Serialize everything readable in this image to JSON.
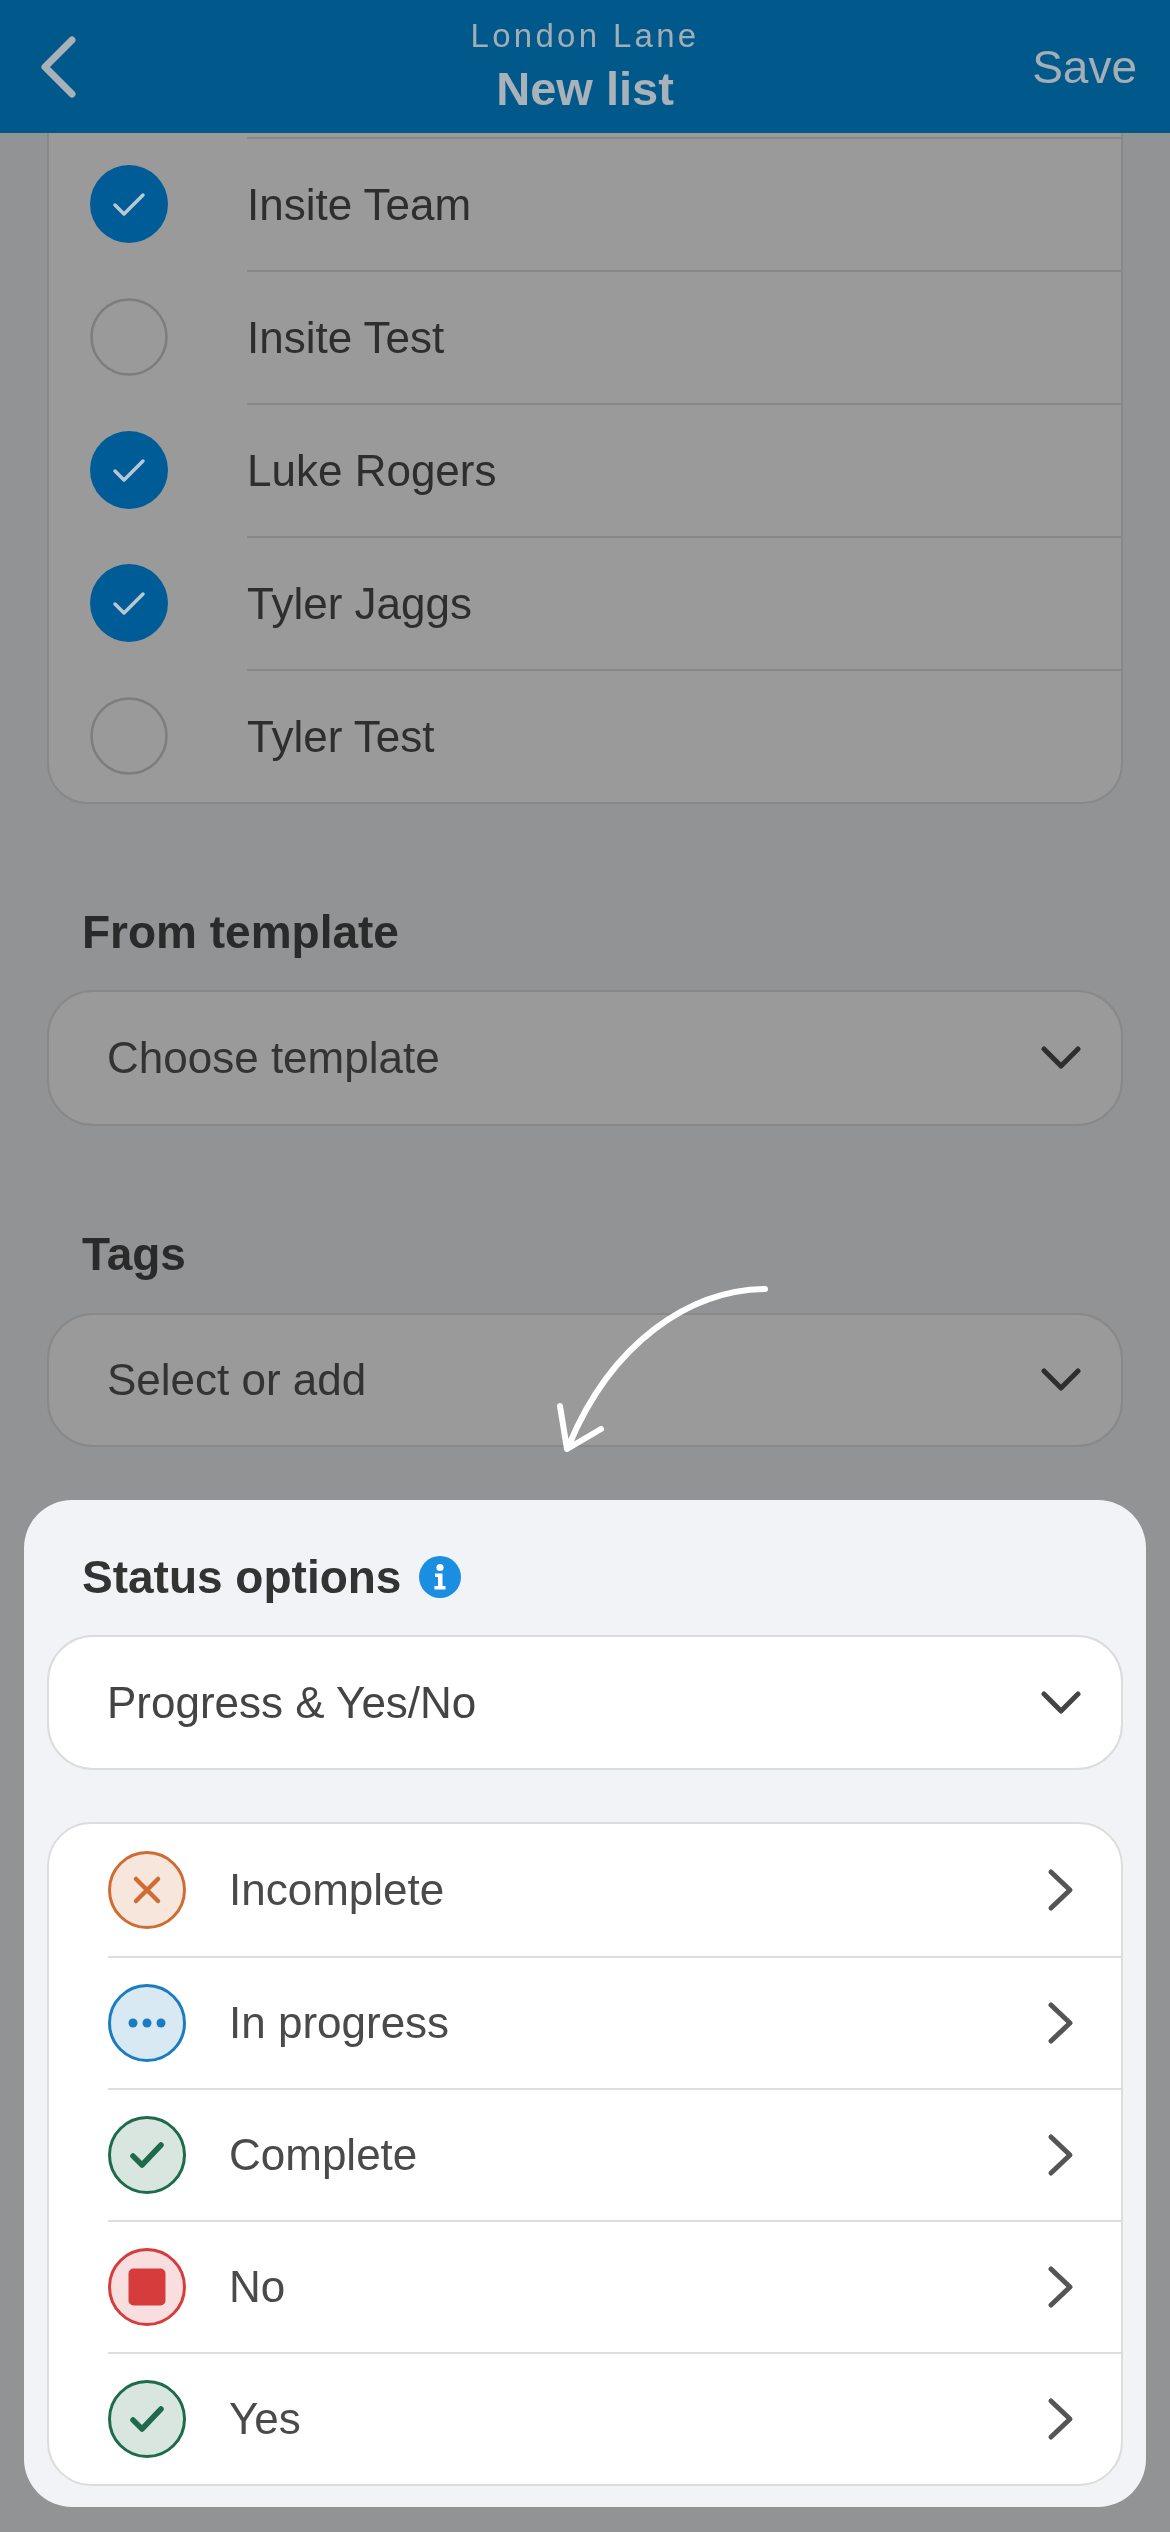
{
  "header": {
    "subtitle": "London Lane",
    "title": "New list",
    "action": "Save"
  },
  "members": [
    {
      "name": "Insite Team",
      "checked": true
    },
    {
      "name": "Insite Test",
      "checked": false
    },
    {
      "name": "Luke Rogers",
      "checked": true
    },
    {
      "name": "Tyler Jaggs",
      "checked": true
    },
    {
      "name": "Tyler Test",
      "checked": false
    }
  ],
  "template": {
    "label": "From template",
    "placeholder": "Choose template"
  },
  "tags": {
    "label": "Tags",
    "placeholder": "Select or add"
  },
  "status_options": {
    "title": "Status options",
    "value": "Progress & Yes/No",
    "statuses": [
      {
        "label": "Incomplete",
        "kind": "cross",
        "color": "#cf6b33"
      },
      {
        "label": "In progress",
        "kind": "dots",
        "color": "#1a7cc1"
      },
      {
        "label": "Complete",
        "kind": "check",
        "color": "#1d6b4a"
      },
      {
        "label": "No",
        "kind": "square",
        "color": "#d63c3c"
      },
      {
        "label": "Yes",
        "kind": "check",
        "color": "#1d6b4a"
      }
    ]
  }
}
